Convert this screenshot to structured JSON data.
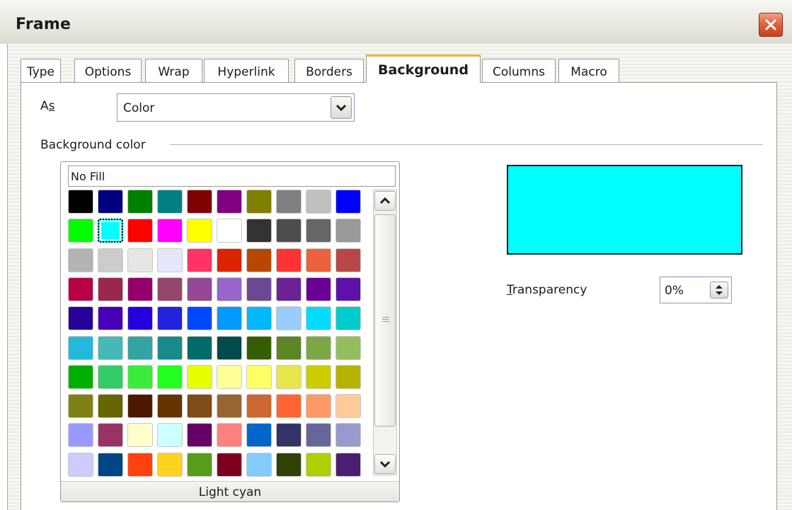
{
  "window": {
    "title": "Frame",
    "close_icon": "close-icon"
  },
  "tabs": [
    {
      "label": "Type",
      "active": false
    },
    {
      "label": "Options",
      "active": false
    },
    {
      "label": "Wrap",
      "active": false
    },
    {
      "label": "Hyperlink",
      "active": false
    },
    {
      "label": "Borders",
      "active": false
    },
    {
      "label": "Background",
      "active": true
    },
    {
      "label": "Columns",
      "active": false
    },
    {
      "label": "Macro",
      "active": false
    }
  ],
  "as_field": {
    "label_pre": "A",
    "label_accel": "s",
    "value": "Color",
    "dropdown_icon": "chevron-down-icon"
  },
  "background_color": {
    "group_label": "Background color",
    "no_fill_label": "No Fill",
    "selected_color_name": "Light cyan",
    "selected_index": 11,
    "preview_color": "#00ffff",
    "swatches": [
      "#000000",
      "#000080",
      "#008000",
      "#008080",
      "#800000",
      "#800080",
      "#808000",
      "#808080",
      "#c0c0c0",
      "#0000ff",
      "#00ff00",
      "#00ffff",
      "#ff0000",
      "#ff00ff",
      "#ffff00",
      "#ffffff",
      "#333333",
      "#4d4d4d",
      "#666666",
      "#999999",
      "#b3b3b3",
      "#cccccc",
      "#e6e6e6",
      "#e6e6ff",
      "#ff3366",
      "#dc2300",
      "#b84700",
      "#ff3333",
      "#eb613d",
      "#b84747",
      "#b80047",
      "#99284c",
      "#94006b",
      "#94476b",
      "#944794",
      "#9966cc",
      "#6b4794",
      "#6b2394",
      "#6b0094",
      "#5e11a6",
      "#28009a",
      "#4700b8",
      "#2300dc",
      "#2323dc",
      "#0047ff",
      "#0099ff",
      "#00b8ff",
      "#99ccff",
      "#00dcff",
      "#00cccc",
      "#23b8dc",
      "#47b8b8",
      "#33a3a3",
      "#198a8a",
      "#006b6b",
      "#004a4a",
      "#355e00",
      "#5c8526",
      "#7da647",
      "#94bd5e",
      "#00ae00",
      "#33cc66",
      "#3deb3d",
      "#23ff23",
      "#e6ff00",
      "#ffff99",
      "#ffff66",
      "#e6e64c",
      "#cccc00",
      "#b3b300",
      "#808019",
      "#666600",
      "#4c1900",
      "#663300",
      "#804c19",
      "#996633",
      "#cc6633",
      "#ff6633",
      "#ff9966",
      "#ffcc99",
      "#9999ff",
      "#993366",
      "#ffffcc",
      "#ccffff",
      "#660066",
      "#ff8080",
      "#0066cc",
      "#333366",
      "#666699",
      "#9999cc",
      "#ccccff",
      "#004586",
      "#ff420e",
      "#ffd320",
      "#579d1c",
      "#7e0021",
      "#83caff",
      "#314004",
      "#aecf00",
      "#4b1f6f"
    ],
    "scroll_up_icon": "chevron-up-icon",
    "scroll_down_icon": "chevron-down-icon"
  },
  "transparency": {
    "label_accel": "T",
    "label_rest": "ransparency",
    "value": "0%",
    "spin_icon": "spin-arrows-icon"
  }
}
